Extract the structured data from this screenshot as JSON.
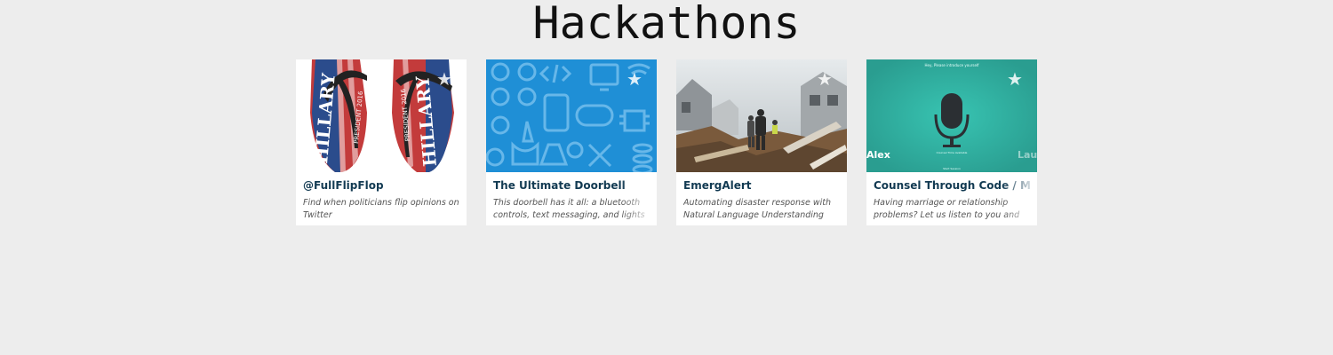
{
  "page": {
    "title": "Hackathons"
  },
  "cards": [
    {
      "title": "@FullFlipFlop",
      "description": "Find when politicians flip opinions on Twitter",
      "thumb_bg": "#ffffff",
      "image_text": [
        "HILLARY",
        "PRESIDENT 2016"
      ]
    },
    {
      "title": "The Ultimate Doorbell",
      "description": "This doorbell has it all: a bluetooth controls, text messaging, and lights to",
      "thumb_bg": "#1f8fd6"
    },
    {
      "title": "EmergAlert",
      "description": "Automating disaster response with Natural Language Understanding",
      "thumb_bg": "#9aa3a8"
    },
    {
      "title": "Counsel Through Code / Marriage Counselor",
      "description": "Having marriage or relationship problems? Let us listen to you and",
      "thumb_bg": "#2fa89a",
      "image_text": [
        "Hey, Please introduce yourself",
        "Alex",
        "Laura",
        "Counsel Time Available",
        "Start Session"
      ]
    }
  ]
}
